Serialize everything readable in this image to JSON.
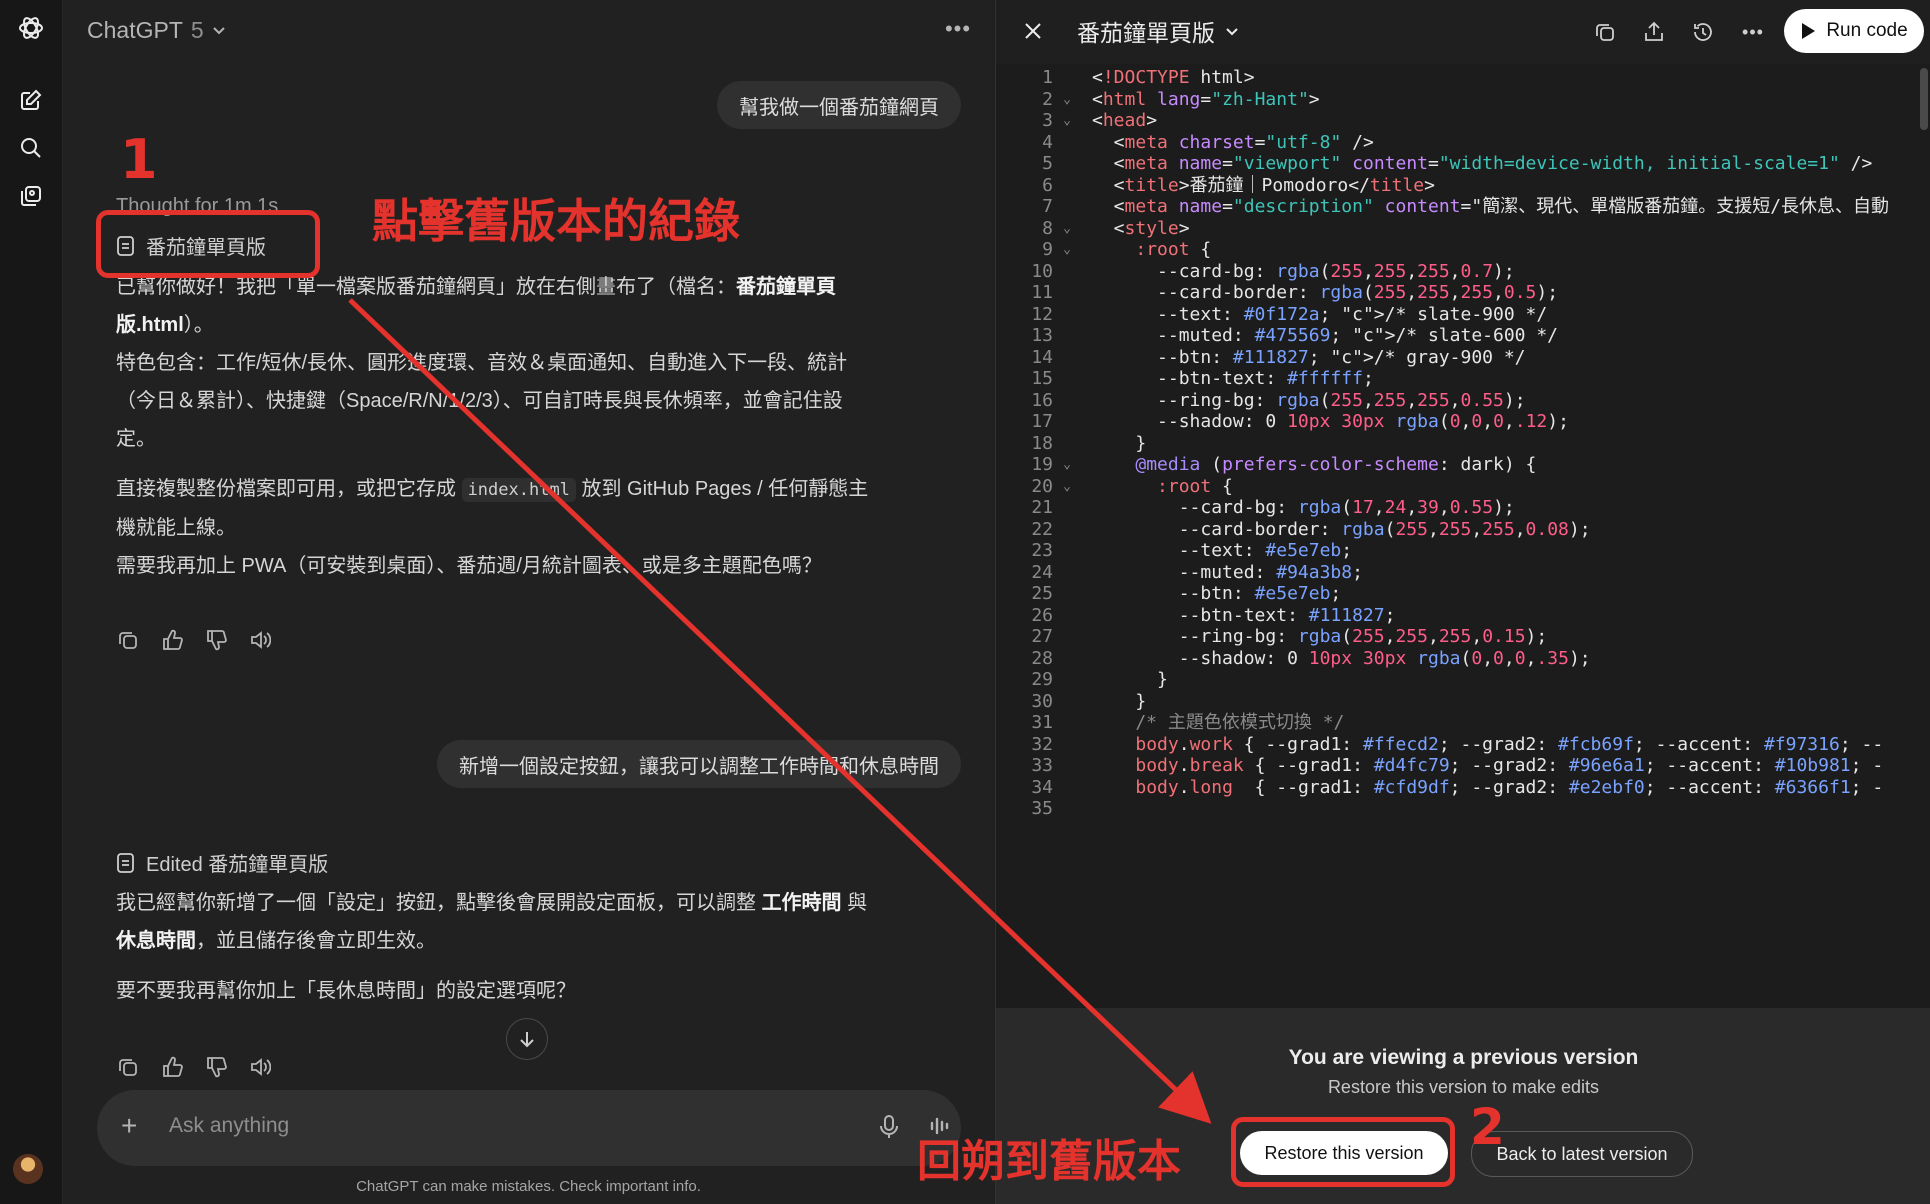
{
  "app": {
    "model_name": "ChatGPT",
    "model_version": "5"
  },
  "rail": {
    "icons": [
      "openai-logo-icon",
      "new-chat-icon",
      "search-icon",
      "library-icon",
      "avatar"
    ]
  },
  "chat": {
    "msg1_user": "幫我做一個番茄鐘網頁",
    "thought": "Thought for 1m 1s",
    "artifact1_label": "番茄鐘單頁版",
    "reply1_line1_pre": "已幫你做好！我把「單一檔案版番茄鐘網頁」放在右側畫布了（檔名：",
    "reply1_line1_bold": "番茄鐘單頁",
    "reply1_line2_bold": "版.html",
    "reply1_line2_post": "）。",
    "reply1_line3": "特色包含：工作/短休/長休、圓形進度環、音效＆桌面通知、自動進入下一段、統計",
    "reply1_line4": "（今日＆累計）、快捷鍵（Space/R/N/1/2/3）、可自訂時長與長休頻率，並會記住設",
    "reply1_line5": "定。",
    "reply1_line6_pre": "直接複製整份檔案即可用，或把它存成",
    "reply1_line6_code": "index.html",
    "reply1_line6_post": "放到 GitHub Pages / 任何靜態主",
    "reply1_line7": "機就能上線。",
    "reply1_line8": "需要我再加上 PWA（可安裝到桌面）、番茄週/月統計圖表、或是多主題配色嗎？",
    "msg2_user": "新增一個設定按鈕，讓我可以調整工作時間和休息時間",
    "artifact2_label": "Edited 番茄鐘單頁版",
    "reply2_line1_pre": "我已經幫你新增了一個「設定」按鈕，點擊後會展開設定面板，可以調整",
    "reply2_line1_bold1": "工作時間",
    "reply2_line1_mid": "與",
    "reply2_line2_bold2": "休息時間",
    "reply2_line2_post": "，並且儲存後會立即生效。",
    "reply2_line3": "要不要我再幫你加上「長休息時間」的設定選項呢？",
    "composer_placeholder": "Ask anything",
    "footer": "ChatGPT can make mistakes. Check important info."
  },
  "canvas": {
    "title": "番茄鐘單頁版",
    "run_label": "Run code",
    "prev_title": "You are viewing a previous version",
    "prev_sub": "Restore this version to make edits",
    "restore_label": "Restore this version",
    "latest_label": "Back to latest version",
    "code_lines": [
      "<!DOCTYPE html>",
      "<html lang=\"zh-Hant\">",
      "<head>",
      "  <meta charset=\"utf-8\" />",
      "  <meta name=\"viewport\" content=\"width=device-width, initial-scale=1\" />",
      "  <title>番茄鐘｜Pomodoro</title>",
      "  <meta name=\"description\" content=\"簡潔、現代、單檔版番茄鐘。支援短/長休息、自動",
      "  <style>",
      "    :root {",
      "      --card-bg: rgba(255,255,255,0.7);",
      "      --card-border: rgba(255,255,255,0.5);",
      "      --text: #0f172a; /* slate-900 */",
      "      --muted: #475569; /* slate-600 */",
      "      --btn: #111827; /* gray-900 */",
      "      --btn-text: #ffffff;",
      "      --ring-bg: rgba(255,255,255,0.55);",
      "      --shadow: 0 10px 30px rgba(0,0,0,.12);",
      "    }",
      "    @media (prefers-color-scheme: dark) {",
      "      :root {",
      "        --card-bg: rgba(17,24,39,0.55);",
      "        --card-border: rgba(255,255,255,0.08);",
      "        --text: #e5e7eb;",
      "        --muted: #94a3b8;",
      "        --btn: #e5e7eb;",
      "        --btn-text: #111827;",
      "        --ring-bg: rgba(255,255,255,0.15);",
      "        --shadow: 0 10px 30px rgba(0,0,0,.35);",
      "      }",
      "    }",
      "    /* 主題色依模式切換 */",
      "    body.work { --grad1: #ffecd2; --grad2: #fcb69f; --accent: #f97316; --",
      "    body.break { --grad1: #d4fc79; --grad2: #96e6a1; --accent: #10b981; -",
      "    body.long  { --grad1: #cfd9df; --grad2: #e2ebf0; --accent: #6366f1; -",
      ""
    ],
    "fold_lines": [
      2,
      3,
      8,
      9,
      19,
      20
    ]
  },
  "annotations": {
    "step1_number": "1",
    "step1_text": "點擊舊版本的紀錄",
    "step2_number": "2",
    "step2_text": "回朔到舊版本"
  },
  "colors": {
    "annotation_red": "#e4322d",
    "accent_white": "#ffffff",
    "code_bg": "#1c1c1c"
  }
}
